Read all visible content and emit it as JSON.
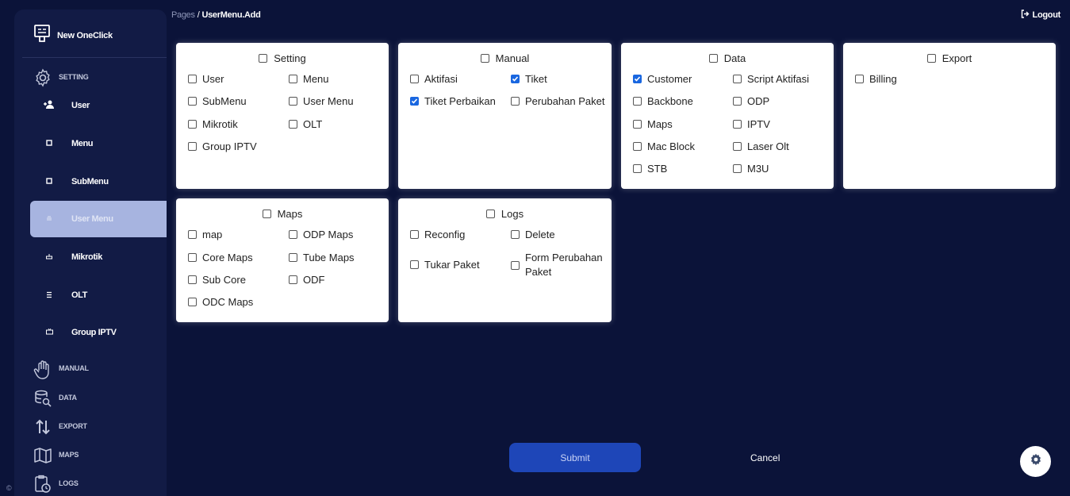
{
  "sidebar": {
    "brand": "New OneClick",
    "sections": {
      "setting": "SETTING",
      "manual": "MANUAL",
      "data": "DATA",
      "export": "EXPORT",
      "maps": "MAPS",
      "logs": "LOGS"
    },
    "items": [
      {
        "label": "User",
        "icon": "add-user-icon"
      },
      {
        "label": "Menu",
        "icon": "square-icon"
      },
      {
        "label": "SubMenu",
        "icon": "square-icon"
      },
      {
        "label": "User Menu",
        "icon": "tray-icon",
        "active": true
      },
      {
        "label": "Mikrotik",
        "icon": "router-icon"
      },
      {
        "label": "OLT",
        "icon": "list-icon"
      },
      {
        "label": "Group IPTV",
        "icon": "tv-icon"
      }
    ],
    "copyright": "©"
  },
  "header": {
    "breadcrumb_parent": "Pages",
    "breadcrumb_sep": "/",
    "breadcrumb_current": "UserMenu.Add",
    "logout_label": "Logout"
  },
  "cards": {
    "setting": {
      "title": "Setting",
      "options": [
        {
          "label": "User",
          "checked": false
        },
        {
          "label": "Menu",
          "checked": false
        },
        {
          "label": "SubMenu",
          "checked": false
        },
        {
          "label": "User Menu",
          "checked": false
        },
        {
          "label": "Mikrotik",
          "checked": false
        },
        {
          "label": "OLT",
          "checked": false
        },
        {
          "label": "Group IPTV",
          "checked": false
        }
      ]
    },
    "manual": {
      "title": "Manual",
      "options": [
        {
          "label": "Aktifasi",
          "checked": false
        },
        {
          "label": "Tiket",
          "checked": true
        },
        {
          "label": "Tiket Perbaikan",
          "checked": true
        },
        {
          "label": "Perubahan Paket",
          "checked": false
        }
      ]
    },
    "data": {
      "title": "Data",
      "options": [
        {
          "label": "Customer",
          "checked": true
        },
        {
          "label": "Script Aktifasi",
          "checked": false
        },
        {
          "label": "Backbone",
          "checked": false
        },
        {
          "label": "ODP",
          "checked": false
        },
        {
          "label": "Maps",
          "checked": false
        },
        {
          "label": "IPTV",
          "checked": false
        },
        {
          "label": "Mac Block",
          "checked": false
        },
        {
          "label": "Laser Olt",
          "checked": false
        },
        {
          "label": "STB",
          "checked": false
        },
        {
          "label": "M3U",
          "checked": false
        }
      ]
    },
    "export": {
      "title": "Export",
      "options": [
        {
          "label": "Billing",
          "checked": false
        }
      ]
    },
    "maps": {
      "title": "Maps",
      "options": [
        {
          "label": "map",
          "checked": false
        },
        {
          "label": "ODP Maps",
          "checked": false
        },
        {
          "label": "Core Maps",
          "checked": false
        },
        {
          "label": "Tube Maps",
          "checked": false
        },
        {
          "label": "Sub Core",
          "checked": false
        },
        {
          "label": "ODF",
          "checked": false
        },
        {
          "label": "ODC Maps",
          "checked": false
        }
      ]
    },
    "logs": {
      "title": "Logs",
      "options": [
        {
          "label": "Reconfig",
          "checked": false
        },
        {
          "label": "Delete",
          "checked": false
        },
        {
          "label": "Tukar Paket",
          "checked": false
        },
        {
          "label": "Form Perubahan Paket",
          "checked": false
        }
      ]
    }
  },
  "actions": {
    "submit_label": "Submit",
    "cancel_label": "Cancel"
  },
  "colors": {
    "background": "#0b1339",
    "sidebar": "#121b45",
    "active_item": "#a7b4e0",
    "submit": "#1e46b8",
    "checkbox_checked": "#1a67e0"
  }
}
